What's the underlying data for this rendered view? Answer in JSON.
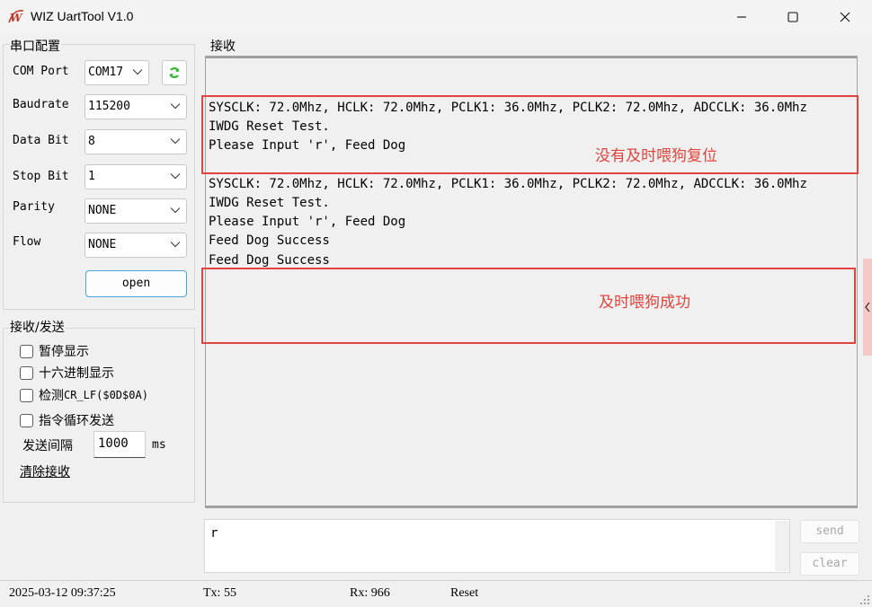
{
  "window": {
    "title": "WIZ UartTool V1.0",
    "logo_letter": "W",
    "controls": [
      "minimize-icon",
      "maximize-icon",
      "close-icon"
    ]
  },
  "serial_config": {
    "group_title": "串口配置",
    "com_port": {
      "label": "COM Port",
      "value": "COM17"
    },
    "baudrate": {
      "label": "Baudrate",
      "value": "115200"
    },
    "data_bit": {
      "label": "Data Bit",
      "value": "8"
    },
    "stop_bit": {
      "label": "Stop Bit",
      "value": "1"
    },
    "parity": {
      "label": "Parity",
      "value": "NONE"
    },
    "flow": {
      "label": "Flow",
      "value": "NONE"
    },
    "open_button": "open",
    "refresh_icon": "refresh-icon"
  },
  "send_recv": {
    "group_title": "接收/发送",
    "pause_display": {
      "label": "暂停显示",
      "checked": false
    },
    "hex_display": {
      "label": "十六进制显示",
      "checked": false
    },
    "detect_crlf": {
      "label_prefix": "检测",
      "label_mono": "CR_LF($0D$0A)",
      "checked": false
    },
    "loop_send": {
      "label": "指令循环发送",
      "checked": false
    },
    "interval_label": "发送间隔",
    "interval_value": "1000",
    "interval_unit": "ms",
    "clear_receive": "清除接收"
  },
  "receive": {
    "group_title": "接收",
    "text": "SYSCLK: 72.0Mhz, HCLK: 72.0Mhz, PCLK1: 36.0Mhz, PCLK2: 72.0Mhz, ADCCLK: 36.0Mhz\nIWDG Reset Test.\nPlease Input 'r', Feed Dog\n\nSYSCLK: 72.0Mhz, HCLK: 72.0Mhz, PCLK1: 36.0Mhz, PCLK2: 72.0Mhz, ADCCLK: 36.0Mhz\nIWDG Reset Test.\nPlease Input 'r', Feed Dog\nFeed Dog Success\nFeed Dog Success",
    "annotation_1": "没有及时喂狗复位",
    "annotation_2": "及时喂狗成功",
    "annotation_color": "#e0443d"
  },
  "send": {
    "input_value": "r",
    "send_button": "send",
    "clear_button": "clear"
  },
  "status": {
    "datetime": "2025-03-12 09:37:25",
    "tx": "Tx: 55",
    "rx": "Rx: 966",
    "reset": "Reset"
  }
}
